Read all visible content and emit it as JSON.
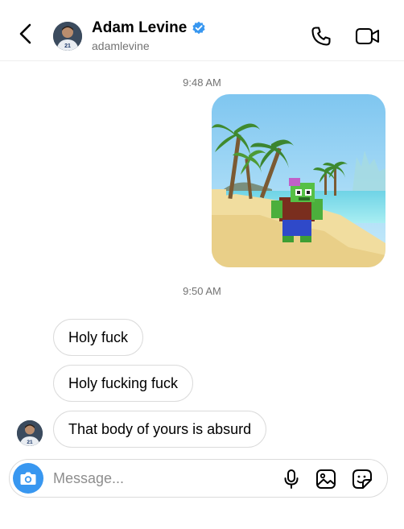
{
  "header": {
    "display_name": "Adam Levine",
    "username": "adamlevine",
    "verified": true,
    "back_icon": "chevron-left-icon",
    "call_icon": "phone-icon",
    "video_icon": "video-camera-icon"
  },
  "thread": {
    "timestamps": [
      "9:48 AM",
      "9:50 AM"
    ],
    "sent_image": {
      "icon": "image-message",
      "description_kind": "voxel-zombie-on-beach"
    },
    "received_messages": [
      {
        "text": "Holy fuck"
      },
      {
        "text": "Holy fucking fuck"
      },
      {
        "text": "That body of yours is absurd"
      }
    ]
  },
  "composer": {
    "placeholder": "Message...",
    "camera_icon": "camera-icon",
    "mic_icon": "microphone-icon",
    "gallery_icon": "gallery-icon",
    "sticker_icon": "sticker-icon"
  },
  "colors": {
    "accent_blue": "#3897f0",
    "verified_blue": "#3897f0",
    "border": "#dbdbdb",
    "secondary_text": "#737373"
  }
}
